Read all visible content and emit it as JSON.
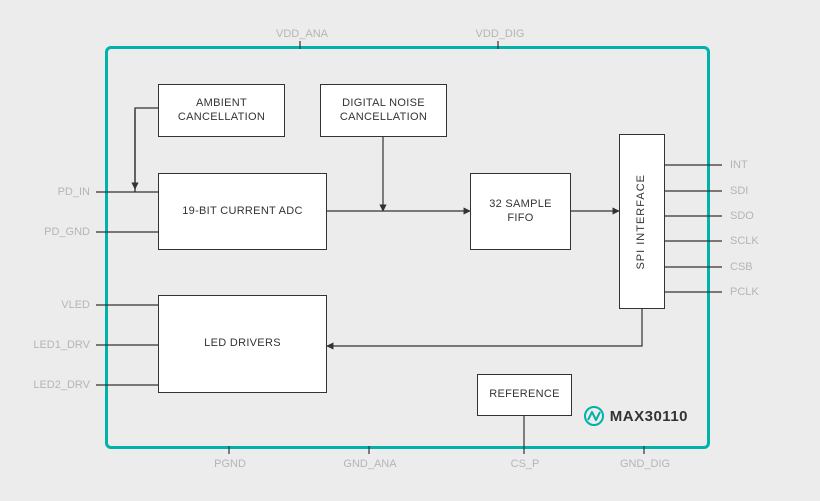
{
  "part": {
    "number": "MAX30110"
  },
  "pins": {
    "top": [
      {
        "key": "vdd_ana",
        "label": "VDD_ANA"
      },
      {
        "key": "vdd_dig",
        "label": "VDD_DIG"
      }
    ],
    "bottom": [
      {
        "key": "pgnd",
        "label": "PGND"
      },
      {
        "key": "gnd_ana",
        "label": "GND_ANA"
      },
      {
        "key": "cs_p",
        "label": "CS_P"
      },
      {
        "key": "gnd_dig",
        "label": "GND_DIG"
      }
    ],
    "left": [
      {
        "key": "pd_in",
        "label": "PD_IN"
      },
      {
        "key": "pd_gnd",
        "label": "PD_GND"
      },
      {
        "key": "vled",
        "label": "VLED"
      },
      {
        "key": "led1_drv",
        "label": "LED1_DRV"
      },
      {
        "key": "led2_drv",
        "label": "LED2_DRV"
      }
    ],
    "right": [
      {
        "key": "int",
        "label": "INT"
      },
      {
        "key": "sdi",
        "label": "SDI"
      },
      {
        "key": "sdo",
        "label": "SDO"
      },
      {
        "key": "sclk",
        "label": "SCLK"
      },
      {
        "key": "csb",
        "label": "CSB"
      },
      {
        "key": "pclk",
        "label": "PCLK"
      }
    ]
  },
  "blocks": {
    "ambient": {
      "label": "AMBIENT CANCELLATION"
    },
    "noise": {
      "label": "DIGITAL NOISE CANCELLATION"
    },
    "adc": {
      "label": "19-BIT CURRENT ADC"
    },
    "fifo": {
      "label": "32 SAMPLE FIFO"
    },
    "spi": {
      "label": "SPI INTERFACE"
    },
    "led": {
      "label": "LED DRIVERS"
    },
    "reference": {
      "label": "REFERENCE"
    }
  }
}
